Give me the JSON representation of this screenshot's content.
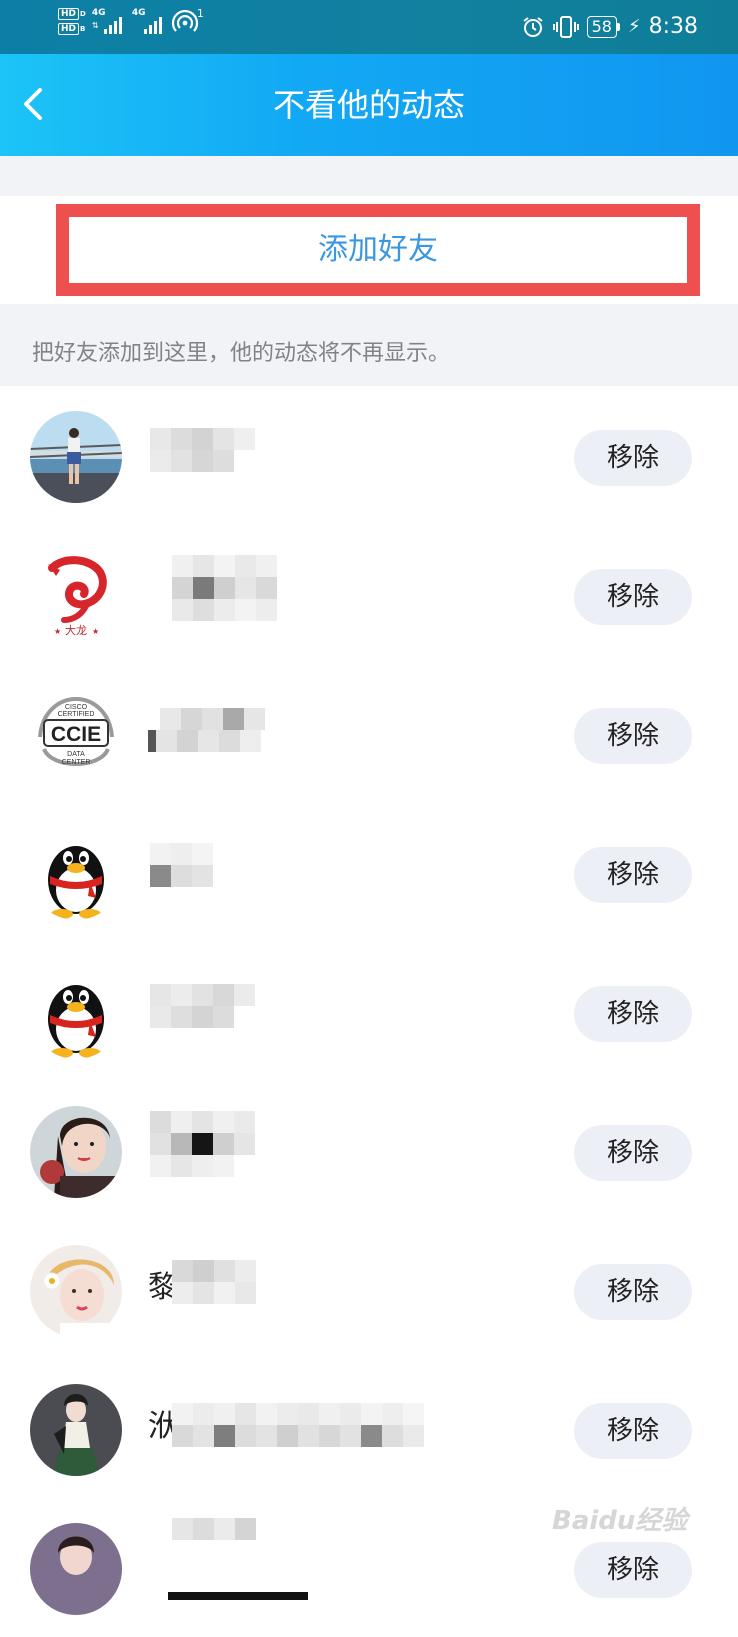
{
  "status_bar": {
    "hd1": "HD",
    "hd2": "HD",
    "net1": "4G",
    "net2": "4G",
    "wifi_num": "1",
    "battery": "58",
    "time": "8:38"
  },
  "header": {
    "title": "不看他的动态"
  },
  "add_friend": {
    "label": "添加好友"
  },
  "hint": "把好友添加到这里，他的动态将不再显示。",
  "friends": [
    {
      "name": "",
      "avatar": "photo-woman-deck",
      "remove_label": "移除"
    },
    {
      "name": "",
      "avatar": "dragon-logo",
      "remove_label": "移除"
    },
    {
      "name": "",
      "avatar": "ccie-badge",
      "remove_label": "移除"
    },
    {
      "name": "",
      "avatar": "qq-penguin",
      "remove_label": "移除"
    },
    {
      "name": "",
      "avatar": "qq-penguin",
      "remove_label": "移除"
    },
    {
      "name": "",
      "avatar": "photo-woman-portrait",
      "remove_label": "移除"
    },
    {
      "name": "黎",
      "avatar": "photo-woman-flower",
      "remove_label": "移除"
    },
    {
      "name": "洑",
      "avatar": "photo-woman-illustration",
      "remove_label": "移除"
    },
    {
      "name": "",
      "avatar": "photo-woman-partial",
      "remove_label": "移除"
    }
  ],
  "ccie_text": {
    "top": "CISCO",
    "mid": "CERTIFIED",
    "main": "CCIE",
    "sub1": "DATA",
    "sub2": "CENTER"
  },
  "dragon_text": "大龙",
  "watermark": "Baidu经验",
  "colors": {
    "header_start": "#1cc4f7",
    "header_end": "#1196f0",
    "status_bar": "#0d7fa6",
    "highlight_border": "#ee4f4f",
    "add_friend_text": "#3a97e0",
    "remove_bg": "#eceff5",
    "section_bg": "#f2f3f6"
  }
}
